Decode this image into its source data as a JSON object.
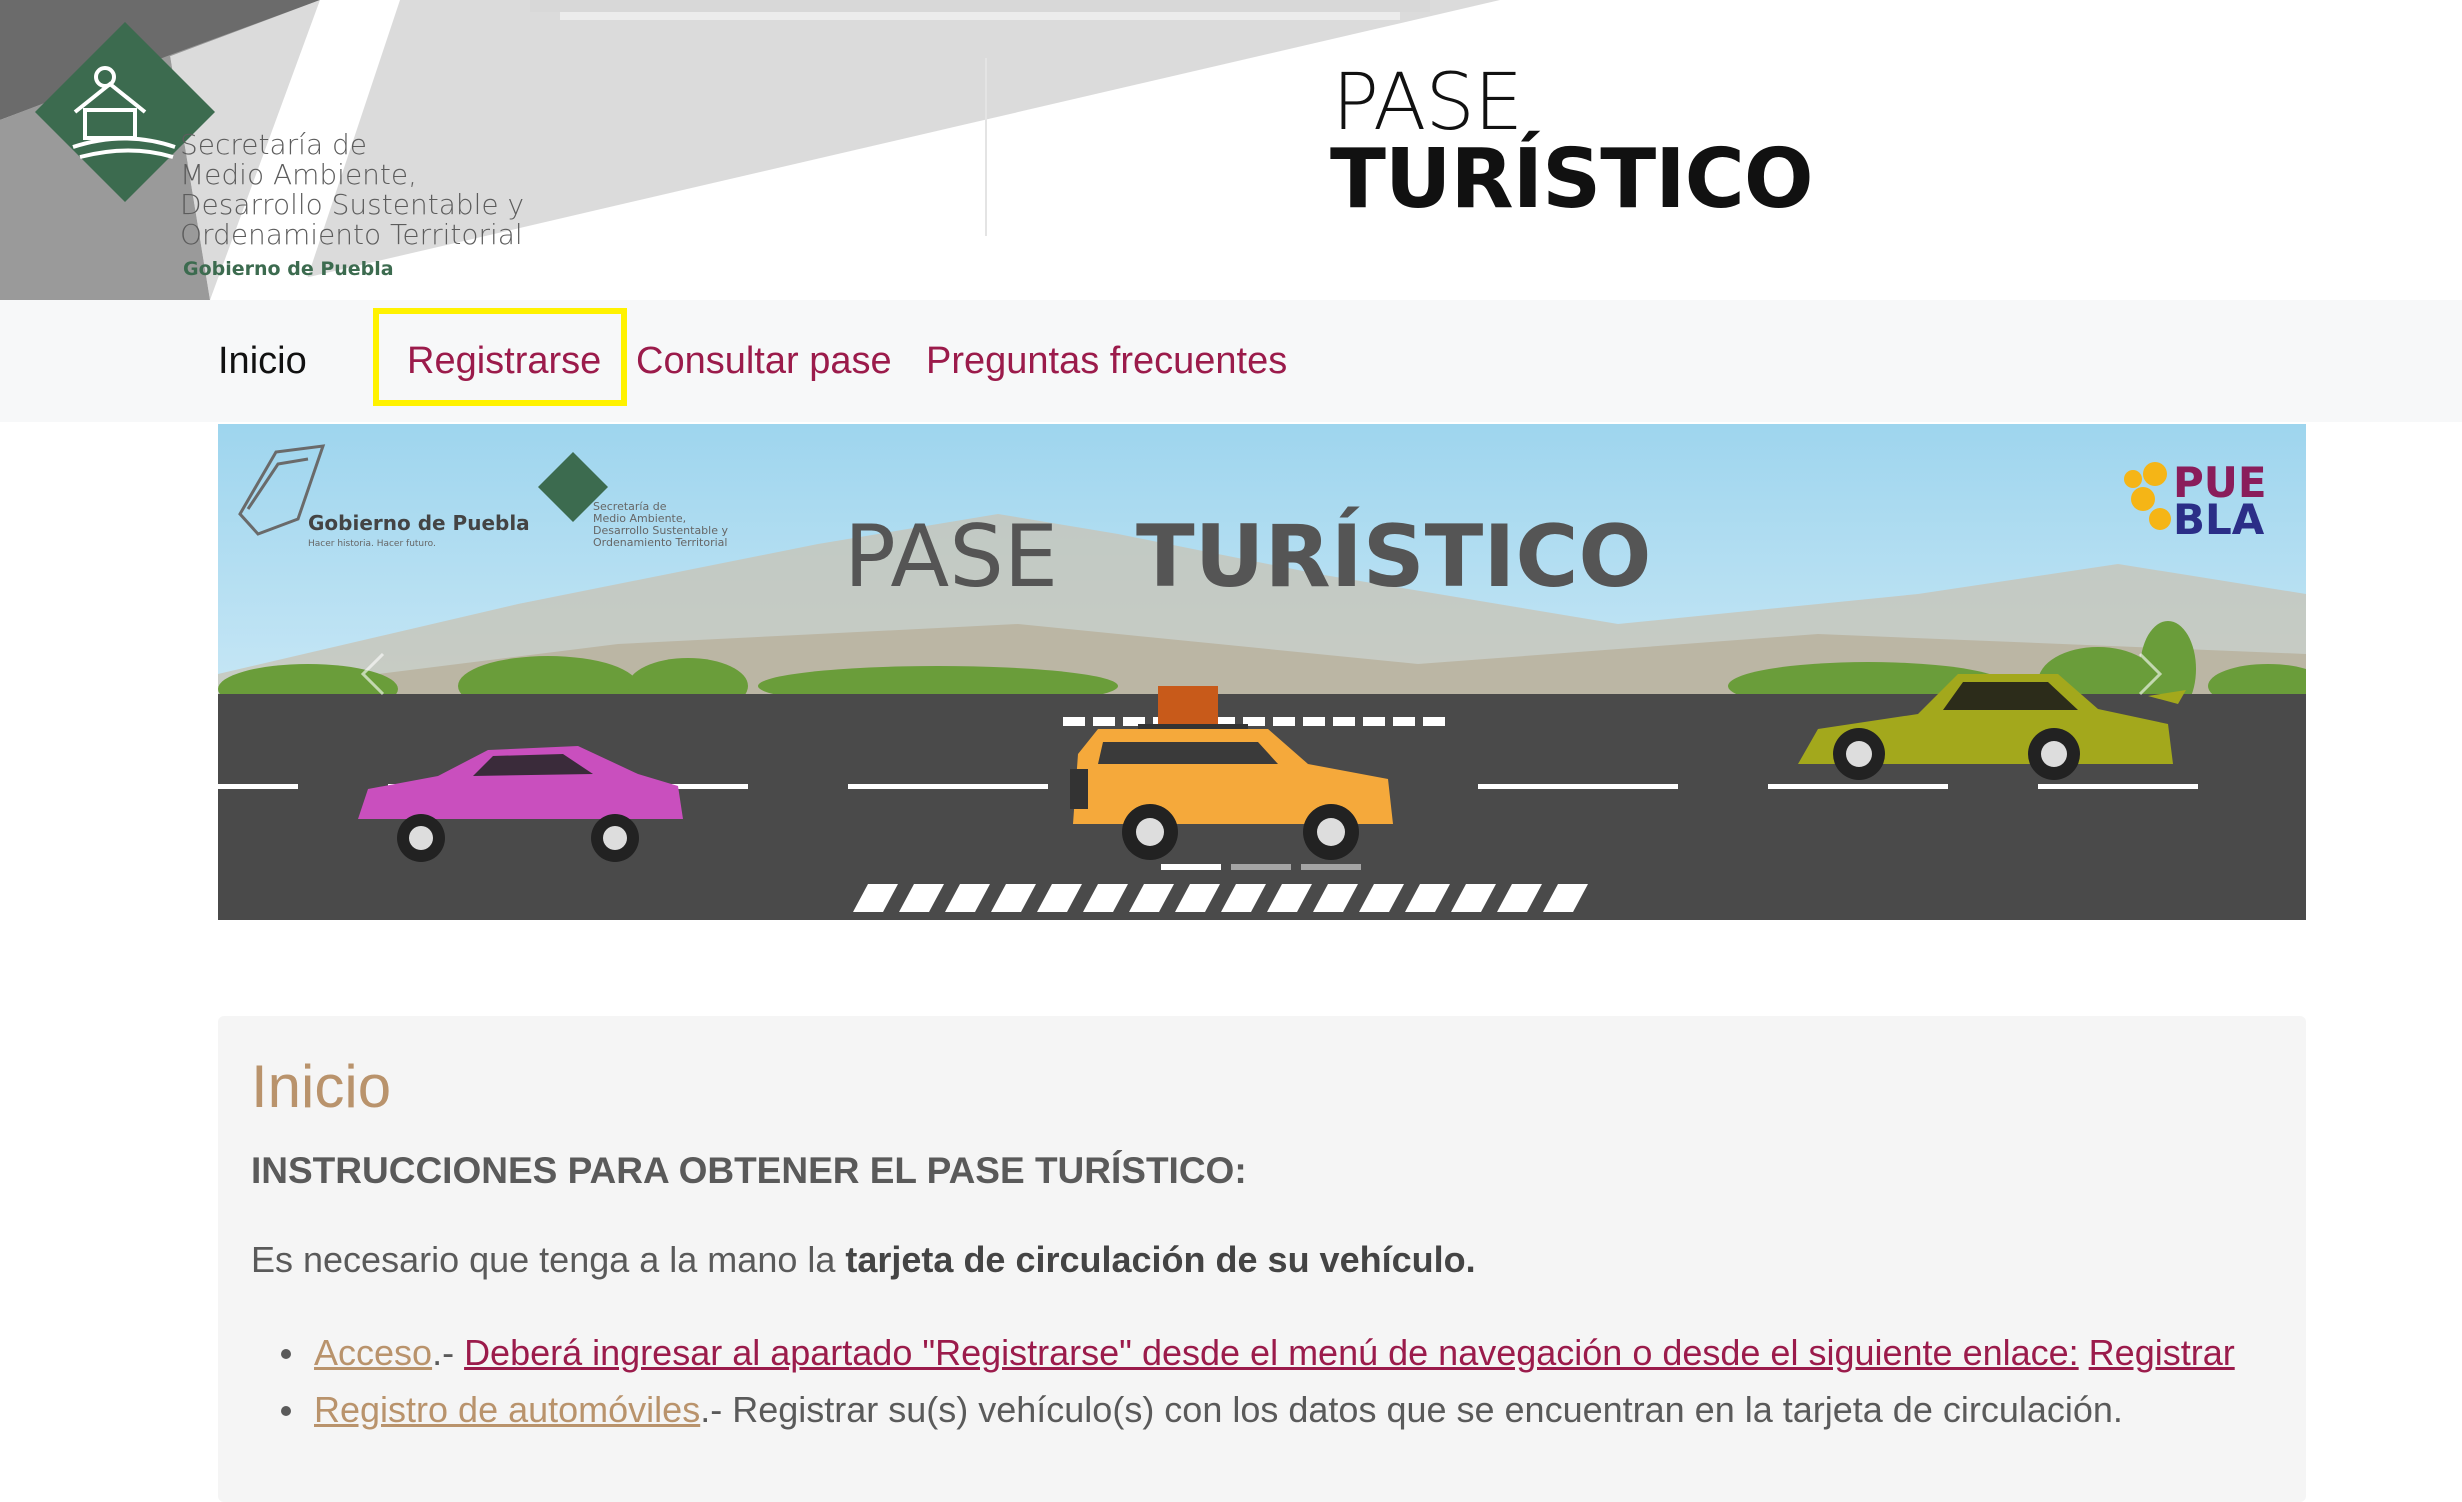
{
  "header": {
    "secretaria_lines": [
      "Secretaría de",
      "Medio Ambiente,",
      "Desarrollo Sustentable y",
      "Ordenamiento Territorial"
    ],
    "gobierno": "Gobierno de Puebla",
    "title_line1": "PASE",
    "title_line2": "TURÍSTICO"
  },
  "nav": {
    "items": [
      {
        "label": "Inicio",
        "active": true
      },
      {
        "label": "Registrarse",
        "active": false
      },
      {
        "label": "Consultar pase",
        "active": false
      },
      {
        "label": "Preguntas frecuentes",
        "active": false
      }
    ]
  },
  "banner": {
    "gobierno": "Gobierno de Puebla",
    "gobierno_tagline": "Hacer historia. Hacer futuro.",
    "secretaria_lines": [
      "Secretaría de",
      "Medio Ambiente,",
      "Desarrollo Sustentable y",
      "Ordenamiento Territorial"
    ],
    "title_light": "PASE",
    "title_bold": "TURÍSTICO",
    "puebla_line1": "PUE",
    "puebla_line2": "BLA",
    "slide_count": 3,
    "active_slide": 1
  },
  "content": {
    "title": "Inicio",
    "subtitle": "INSTRUCCIONES PARA OBTENER EL PASE TURÍSTICO:",
    "intro_prefix": "Es necesario que tenga a la mano la ",
    "intro_bold": "tarjeta de circulación de su vehículo.",
    "steps": [
      {
        "title": "Acceso",
        "sep": ".- ",
        "link_text": "Deberá ingresar al apartado \"Registrarse\" desde el menú de navegación o desde el siguiente enlace:",
        "link2": "Registrar"
      },
      {
        "title": "Registro de automóviles",
        "sep": ".- ",
        "text": "Registrar su(s) vehículo(s) con los datos que se encuentran en la tarjeta de circulación."
      }
    ]
  },
  "colors": {
    "accent_red": "#9b1b4b",
    "accent_gold": "#b9936c",
    "brand_green": "#3c6b4f",
    "highlight": "#fff200"
  }
}
